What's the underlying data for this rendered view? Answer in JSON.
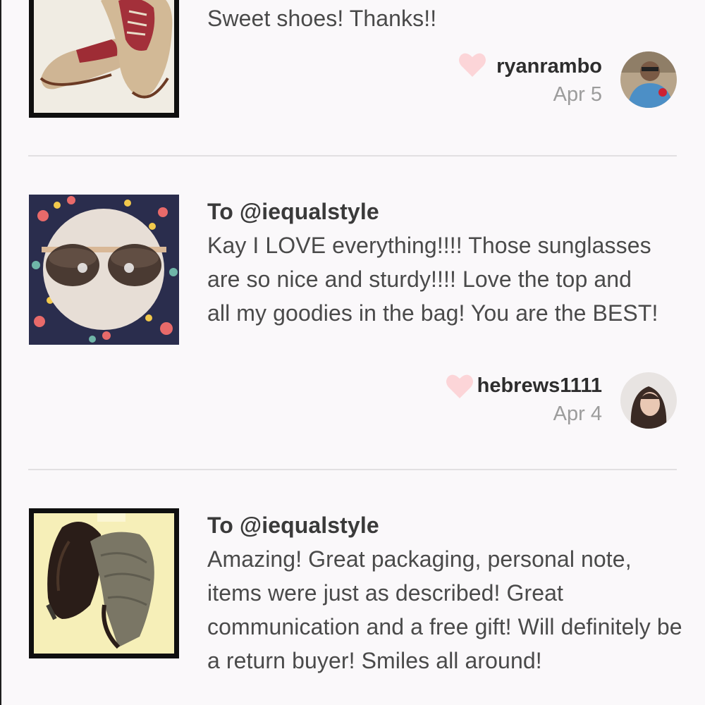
{
  "reviews": [
    {
      "to": "",
      "body": "Sweet shoes! Thanks!!",
      "username": "ryanrambo",
      "date": "Apr 5",
      "photo_icon": "saddle-shoes-photo",
      "avatar_icon": "user-avatar-photo"
    },
    {
      "to": "To @iequalstyle",
      "body": "Kay I LOVE everything!!!! Those sunglasses are so nice and sturdy!!!! Love the top and all my goodies in the bag! You are the BEST!",
      "username": "hebrews1111",
      "date": "Apr 4",
      "photo_icon": "sunglasses-photo",
      "avatar_icon": "user-avatar-photo"
    },
    {
      "to": "To @iequalstyle",
      "body": "Amazing! Great packaging, personal note, items were just as described! Great communication and a free gift! Will definitely be a return buyer! Smiles all around!",
      "photo_icon": "fur-trapper-hat-photo"
    }
  ],
  "colors": {
    "heart": "#fcd5d8",
    "divider": "#e2e0e2",
    "background": "#faf8fa"
  }
}
